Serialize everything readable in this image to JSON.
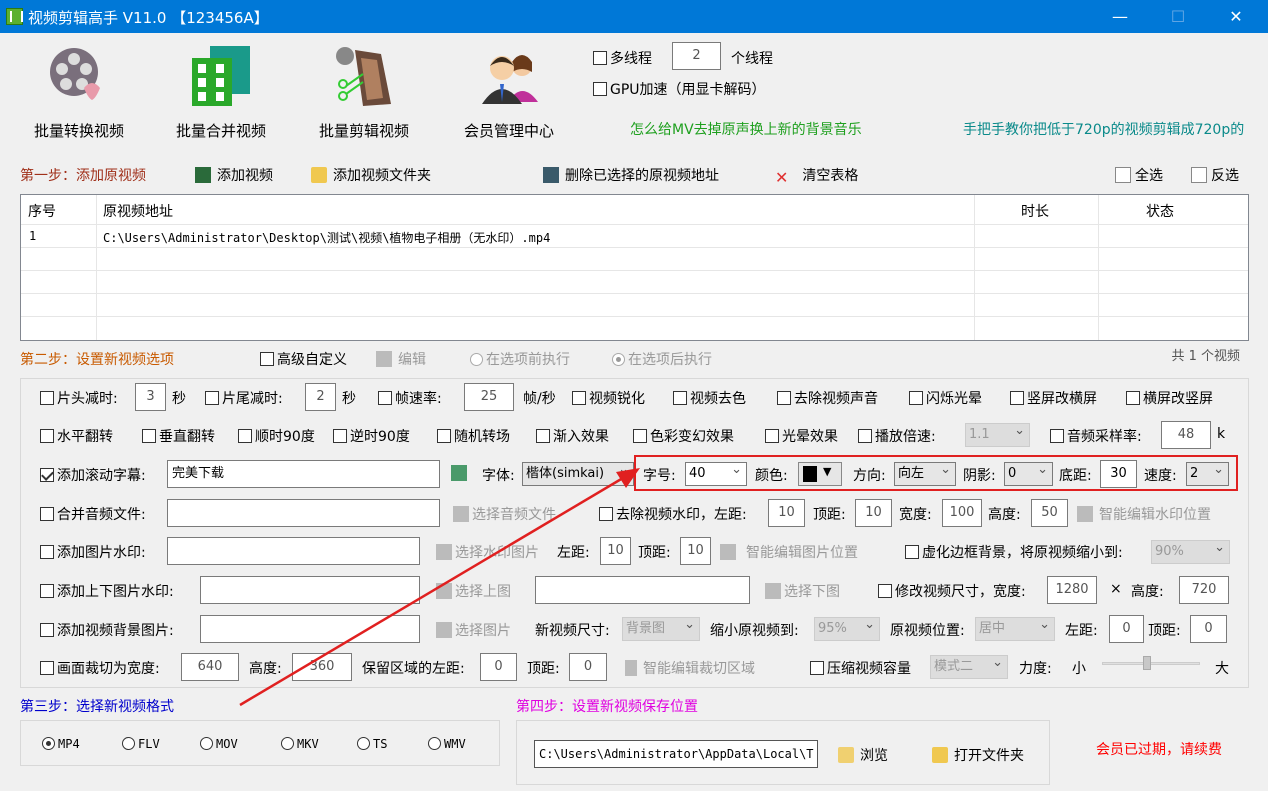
{
  "window": {
    "title": "视频剪辑高手 V11.0 【123456A】",
    "minimize": "—",
    "maximize": "☐",
    "close": "✕"
  },
  "toolbar": [
    {
      "label": "批量转换视频",
      "icon": "film-reel-convert-icon"
    },
    {
      "label": "批量合并视频",
      "icon": "merge-icon"
    },
    {
      "label": "批量剪辑视频",
      "icon": "film-cut-icon"
    },
    {
      "label": "会员管理中心",
      "icon": "members-icon"
    }
  ],
  "threads": {
    "multithread_label": "多线程",
    "count": "2",
    "unit": "个线程",
    "gpu_label": "GPU加速（用显卡解码）"
  },
  "links": {
    "mv_music": "怎么给MV去掉原声换上新的背景音乐",
    "upscale": "手把手教你把低于720p的视频剪辑成720p的"
  },
  "step1": {
    "title": "第一步：添加原视频",
    "add_video": "添加视频",
    "add_folder": "添加视频文件夹",
    "delete_selected": "删除已选择的原视频地址",
    "clear_table": "清空表格",
    "select_all": "全选",
    "invert": "反选"
  },
  "table": {
    "headers": [
      "序号",
      "原视频地址",
      "时长",
      "状态"
    ],
    "rows": [
      {
        "index": "1",
        "path": "C:\\Users\\Administrator\\Desktop\\测试\\视频\\植物电子相册（无水印）.mp4",
        "duration": "",
        "status": ""
      }
    ]
  },
  "step2": {
    "title": "第二步：设置新视频选项",
    "advanced": "高级自定义",
    "edit": "编辑",
    "before": "在选项前执行",
    "after": "在选项后执行",
    "count": "共 1 个视频"
  },
  "opts": {
    "head_cut": "片头减时:",
    "head_val": "3",
    "sec": "秒",
    "tail_cut": "片尾减时:",
    "tail_val": "2",
    "fps": "帧速率:",
    "fps_val": "25",
    "fps_unit": "帧/秒",
    "sharpen": "视频锐化",
    "decolor": "视频去色",
    "mute": "去除视频声音",
    "flash": "闪烁光晕",
    "v2h": "竖屏改横屏",
    "h2v": "横屏改竖屏",
    "hflip": "水平翻转",
    "vflip": "垂直翻转",
    "cw90": "顺时90度",
    "ccw90": "逆时90度",
    "random_trans": "随机转场",
    "fadein": "渐入效果",
    "color_fx": "色彩变幻效果",
    "halo": "光晕效果",
    "speed": "播放倍速:",
    "speed_val": "1.1",
    "samplerate": "音频采样率:",
    "samplerate_val": "48",
    "k": "k",
    "scroll_sub": "添加滚动字幕:",
    "scroll_text": "完美下载",
    "font": "字体:",
    "font_val": "楷体(simkai)",
    "size": "字号:",
    "size_val": "40",
    "color": "颜色:",
    "dir": "方向:",
    "dir_val": "向左",
    "shadow": "阴影:",
    "shadow_val": "0",
    "bottom": "底距:",
    "bottom_val": "30",
    "spd": "速度:",
    "spd_val": "2",
    "merge_audio": "合并音频文件:",
    "choose_audio": "选择音频文件",
    "remove_wm": "去除视频水印，左距:",
    "wm_left": "10",
    "top": "顶距:",
    "wm_top": "10",
    "width": "宽度:",
    "wm_w": "100",
    "height": "高度:",
    "wm_h": "50",
    "smart_wm": "智能编辑水印位置",
    "img_wm": "添加图片水印:",
    "choose_wm_img": "选择水印图片",
    "left": "左距:",
    "img_left": "10",
    "img_top": "10",
    "smart_img": "智能编辑图片位置",
    "blur_border": "虚化边框背景，将原视频缩小到:",
    "blur_val": "90%",
    "tb_wm": "添加上下图片水印:",
    "choose_top": "选择上图",
    "choose_bottom": "选择下图",
    "resize": "修改视频尺寸，宽度:",
    "resize_w": "1280",
    "times": "×",
    "height2": "高度:",
    "resize_h": "720",
    "bg_img": "添加视频背景图片:",
    "choose_img": "选择图片",
    "new_size": "新视频尺寸:",
    "new_size_val": "背景图",
    "shrink": "缩小原视频到:",
    "shrink_val": "95%",
    "pos": "原视频位置:",
    "pos_val": "居中",
    "bg_left": "0",
    "bg_top": "0",
    "crop": "画面裁切为宽度:",
    "crop_w": "640",
    "crop_h": "360",
    "keep_left": "保留区域的左距:",
    "keep_left_val": "0",
    "keep_top": "0",
    "smart_crop": "智能编辑裁切区域",
    "compress": "压缩视频容量",
    "mode": "模式二",
    "strength": "力度:",
    "small": "小",
    "big": "大",
    "strength_level": 0.45
  },
  "step3": {
    "title": "第三步：选择新视频格式",
    "formats": [
      "MP4",
      "FLV",
      "MOV",
      "MKV",
      "TS",
      "WMV"
    ],
    "selected": "MP4"
  },
  "step4": {
    "title": "第四步：设置新视频保存位置",
    "path": "C:\\Users\\Administrator\\AppData\\Local\\T",
    "browse": "浏览",
    "open_folder": "打开文件夹"
  },
  "membership": "会员已过期，请续费",
  "colors": {
    "titlebar": "#0078d7",
    "step1": "#a0301a",
    "step2": "#c85a00",
    "step3": "#0000cc",
    "step4": "#e000e0",
    "expired": "#ff0000",
    "link_green": "#1fa01f",
    "link_teal": "#0a8a8a",
    "highlight": "#e02020"
  }
}
